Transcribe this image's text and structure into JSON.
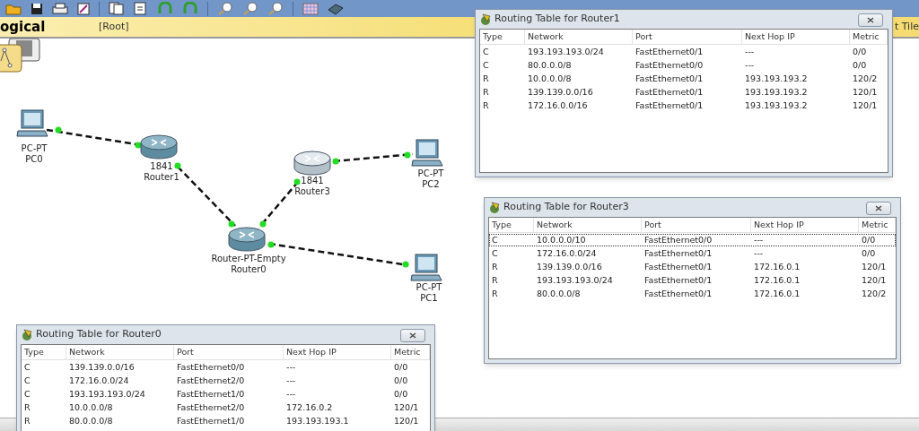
{
  "workspace_bar": {
    "mode": "ogical",
    "path": "[Root]",
    "right_label": "t Tile"
  },
  "devices": [
    {
      "kind": "pc",
      "model": "PC-PT",
      "name": "PC0"
    },
    {
      "kind": "router",
      "model": "1841",
      "name": "Router1"
    },
    {
      "kind": "router_light",
      "model": "1841",
      "name": "Router3"
    },
    {
      "kind": "router",
      "model": "Router-PT-Empty",
      "name": "Router0"
    },
    {
      "kind": "pc",
      "model": "PC-PT",
      "name": "PC2"
    },
    {
      "kind": "pc",
      "model": "PC-PT",
      "name": "PC1"
    }
  ],
  "routing_tables": [
    {
      "title": "Routing Table for Router1",
      "columns": [
        "Type",
        "Network",
        "Port",
        "Next Hop IP",
        "Metric"
      ],
      "rows": [
        {
          "cells": [
            "C",
            "193.193.193.0/24",
            "FastEthernet0/1",
            "---",
            "0/0"
          ],
          "selected": false
        },
        {
          "cells": [
            "C",
            "80.0.0.0/8",
            "FastEthernet0/0",
            "---",
            "0/0"
          ],
          "selected": false
        },
        {
          "cells": [
            "R",
            "10.0.0.0/8",
            "FastEthernet0/1",
            "193.193.193.2",
            "120/2"
          ],
          "selected": false
        },
        {
          "cells": [
            "R",
            "139.139.0.0/16",
            "FastEthernet0/1",
            "193.193.193.2",
            "120/1"
          ],
          "selected": false
        },
        {
          "cells": [
            "R",
            "172.16.0.0/16",
            "FastEthernet0/1",
            "193.193.193.2",
            "120/1"
          ],
          "selected": false
        }
      ]
    },
    {
      "title": "Routing Table for Router3",
      "columns": [
        "Type",
        "Network",
        "Port",
        "Next Hop IP",
        "Metric"
      ],
      "rows": [
        {
          "cells": [
            "C",
            "10.0.0.0/10",
            "FastEthernet0/0",
            "---",
            "0/0"
          ],
          "selected": true
        },
        {
          "cells": [
            "C",
            "172.16.0.0/24",
            "FastEthernet0/1",
            "---",
            "0/0"
          ],
          "selected": false
        },
        {
          "cells": [
            "R",
            "139.139.0.0/16",
            "FastEthernet0/1",
            "172.16.0.1",
            "120/1"
          ],
          "selected": false
        },
        {
          "cells": [
            "R",
            "193.193.193.0/24",
            "FastEthernet0/1",
            "172.16.0.1",
            "120/1"
          ],
          "selected": false
        },
        {
          "cells": [
            "R",
            "80.0.0.0/8",
            "FastEthernet0/1",
            "172.16.0.1",
            "120/2"
          ],
          "selected": false
        }
      ]
    },
    {
      "title": "Routing Table for Router0",
      "columns": [
        "Type",
        "Network",
        "Port",
        "Next Hop IP",
        "Metric"
      ],
      "rows": [
        {
          "cells": [
            "C",
            "139.139.0.0/16",
            "FastEthernet0/0",
            "---",
            "0/0"
          ],
          "selected": false
        },
        {
          "cells": [
            "C",
            "172.16.0.0/24",
            "FastEthernet2/0",
            "---",
            "0/0"
          ],
          "selected": false
        },
        {
          "cells": [
            "C",
            "193.193.193.0/24",
            "FastEthernet1/0",
            "---",
            "0/0"
          ],
          "selected": false
        },
        {
          "cells": [
            "R",
            "10.0.0.0/8",
            "FastEthernet2/0",
            "172.16.0.2",
            "120/1"
          ],
          "selected": false
        },
        {
          "cells": [
            "R",
            "80.0.0.0/8",
            "FastEthernet1/0",
            "193.193.193.1",
            "120/1"
          ],
          "selected": false
        }
      ]
    }
  ]
}
